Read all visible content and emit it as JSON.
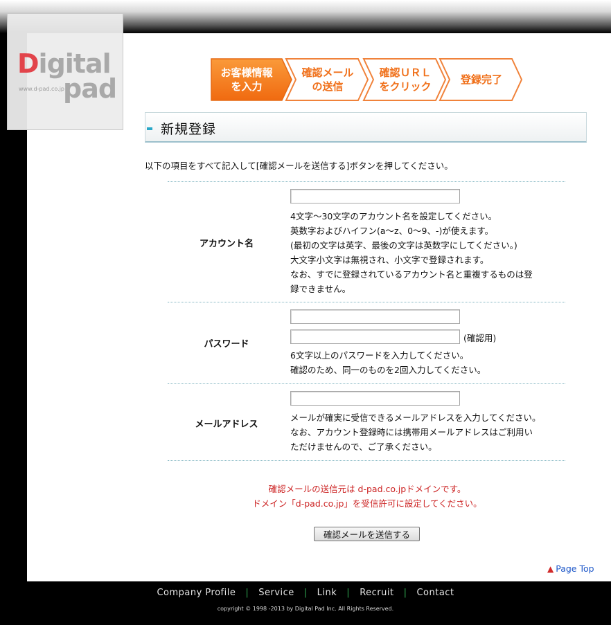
{
  "logo": {
    "digital": "Digital",
    "pad": "pad",
    "url": "www.d-pad.co.jp"
  },
  "steps": [
    {
      "label": "お客様情報\nを入力",
      "active": true
    },
    {
      "label": "確認メール\nの送信",
      "active": false
    },
    {
      "label": "確認ＵＲＬ\nをクリック",
      "active": false
    },
    {
      "label": "登録完了",
      "active": false
    }
  ],
  "colors": {
    "step_active": "#f77a1e",
    "step_border": "#f0823a",
    "step_text_inactive": "#f0701a",
    "warn": "#cc2222",
    "link": "#1a55c8"
  },
  "section": {
    "title": "新規登録"
  },
  "intro": "以下の項目をすべて記入して[確認メールを送信する]ボタンを押してください。",
  "form": {
    "account": {
      "label": "アカウント名",
      "value": "",
      "note": "4文字〜30文字のアカウント名を設定してください。\n英数字およびハイフン(a〜z、0〜9、-)が使えます。\n(最初の文字は英字、最後の文字は英数字にしてください。)\n大文字小文字は無視され、小文字で登録されます。\nなお、すでに登録されているアカウント名と重複するものは登\n録できません。"
    },
    "password": {
      "label": "パスワード",
      "value": "",
      "confirm_value": "",
      "confirm_label": "(確認用)",
      "note": "6文字以上のパスワードを入力してください。\n確認のため、同一のものを2回入力してください。"
    },
    "email": {
      "label": "メールアドレス",
      "value": "",
      "note": "メールが確実に受信できるメールアドレスを入力してください。\nなお、アカウント登録時には携帯用メールアドレスはご利用い\nただけませんので、ご了承ください。"
    }
  },
  "warning": {
    "line1": "確認メールの送信元は d-pad.co.jpドメインです。",
    "line2": "ドメイン「d-pad.co.jp」を受信許可に設定してください。"
  },
  "submit_label": "確認メールを送信する",
  "page_top": "Page Top",
  "footer": {
    "links": [
      "Company Profile",
      "Service",
      "Link",
      "Recruit",
      "Contact"
    ],
    "copyright": "copyright © 1998 -2013 by Digital Pad Inc. All Rights Reserved."
  }
}
